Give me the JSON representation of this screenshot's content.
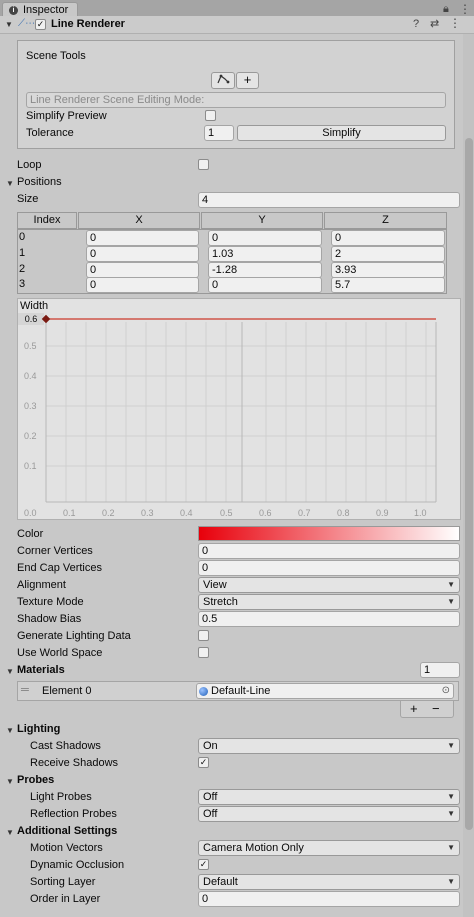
{
  "window": {
    "tab_label": "Inspector"
  },
  "component": {
    "title": "Line Renderer",
    "enabled": true
  },
  "scene_tools": {
    "title": "Scene Tools",
    "mode_placeholder": "Line Renderer Scene Editing Mode:",
    "simplify_preview_label": "Simplify Preview",
    "tolerance_label": "Tolerance",
    "tolerance_value": "1",
    "simplify_button": "Simplify",
    "add_button": "+"
  },
  "loop_label": "Loop",
  "positions": {
    "label": "Positions",
    "size_label": "Size",
    "size_value": "4",
    "headers": [
      "Index",
      "X",
      "Y",
      "Z"
    ],
    "rows": [
      {
        "index": "0",
        "x": "0",
        "y": "0",
        "z": "0"
      },
      {
        "index": "1",
        "x": "0",
        "y": "1.03",
        "z": "2"
      },
      {
        "index": "2",
        "x": "0",
        "y": "-1.28",
        "z": "3.93"
      },
      {
        "index": "3",
        "x": "0",
        "y": "0",
        "z": "5.7"
      }
    ]
  },
  "width_curve": {
    "label": "Width",
    "value_label": "0.6",
    "y_ticks": [
      "0.5",
      "0.4",
      "0.3",
      "0.2",
      "0.1"
    ],
    "x_ticks": [
      "0.0",
      "0.1",
      "0.2",
      "0.3",
      "0.4",
      "0.5",
      "0.6",
      "0.7",
      "0.8",
      "0.9",
      "1.0"
    ]
  },
  "props": {
    "color_label": "Color",
    "corner_vertices_label": "Corner Vertices",
    "corner_vertices_value": "0",
    "end_cap_vertices_label": "End Cap Vertices",
    "end_cap_vertices_value": "0",
    "alignment_label": "Alignment",
    "alignment_value": "View",
    "texture_mode_label": "Texture Mode",
    "texture_mode_value": "Stretch",
    "shadow_bias_label": "Shadow Bias",
    "shadow_bias_value": "0.5",
    "gen_lighting_label": "Generate Lighting Data",
    "use_world_label": "Use World Space"
  },
  "materials": {
    "label": "Materials",
    "count": "1",
    "element_label": "Element 0",
    "element_value": "Default-Line",
    "add": "+",
    "remove": "−"
  },
  "lighting": {
    "label": "Lighting",
    "cast_shadows_label": "Cast Shadows",
    "cast_shadows_value": "On",
    "receive_shadows_label": "Receive Shadows"
  },
  "probes": {
    "label": "Probes",
    "light_probes_label": "Light Probes",
    "light_probes_value": "Off",
    "reflection_probes_label": "Reflection Probes",
    "reflection_probes_value": "Off"
  },
  "additional": {
    "label": "Additional Settings",
    "motion_vectors_label": "Motion Vectors",
    "motion_vectors_value": "Camera Motion Only",
    "dynamic_occlusion_label": "Dynamic Occlusion",
    "sorting_layer_label": "Sorting Layer",
    "sorting_layer_value": "Default",
    "order_in_layer_label": "Order in Layer",
    "order_in_layer_value": "0"
  },
  "colors": {
    "gradient_start": "#e8000b",
    "gradient_end": "#ffffff",
    "curve": "#cc3a2b"
  }
}
